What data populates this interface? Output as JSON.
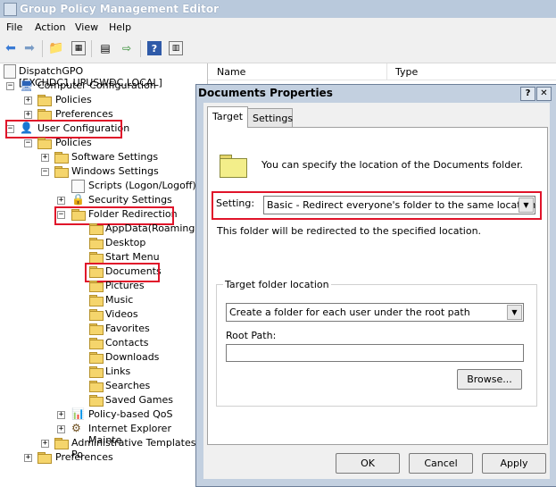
{
  "window": {
    "title": "Group Policy Management Editor",
    "menu": [
      "File",
      "Action",
      "View",
      "Help"
    ]
  },
  "tree": {
    "root": "DispatchGPO [EXCHDC1.UPUSWDC.LOCAL]",
    "computer_config": "Computer Configuration",
    "cc_policies": "Policies",
    "cc_preferences": "Preferences",
    "user_config": "User Configuration",
    "uc_policies": "Policies",
    "software_settings": "Software Settings",
    "windows_settings": "Windows Settings",
    "scripts": "Scripts (Logon/Logoff)",
    "security_settings": "Security Settings",
    "folder_redirection": "Folder Redirection",
    "folders": [
      "AppData(Roaming)",
      "Desktop",
      "Start Menu",
      "Documents",
      "Pictures",
      "Music",
      "Videos",
      "Favorites",
      "Contacts",
      "Downloads",
      "Links",
      "Searches",
      "Saved Games"
    ],
    "policy_qos": "Policy-based QoS",
    "ie_maint": "Internet Explorer Mainte",
    "admin_templates": "Administrative Templates: Po",
    "uc_preferences": "Preferences"
  },
  "list": {
    "col_name": "Name",
    "col_type": "Type"
  },
  "dialog": {
    "title": "Documents Properties",
    "help_glyph": "?",
    "close_glyph": "✕",
    "tabs": [
      "Target",
      "Settings"
    ],
    "description": "You can specify the location of the Documents folder.",
    "setting_label": "Setting:",
    "setting_value": "Basic - Redirect everyone's folder to the same location",
    "redirect_note": "This folder will be redirected to the specified location.",
    "group_label": "Target folder location",
    "target_value": "Create a folder for each user under the root path",
    "root_path_label": "Root Path:",
    "root_path_value": "",
    "browse": "Browse...",
    "ok": "OK",
    "cancel": "Cancel",
    "apply": "Apply"
  },
  "colors": {
    "highlight_box": "#e0142a",
    "title_bar": "#b9c9dc",
    "folder": "#f5d56c"
  }
}
